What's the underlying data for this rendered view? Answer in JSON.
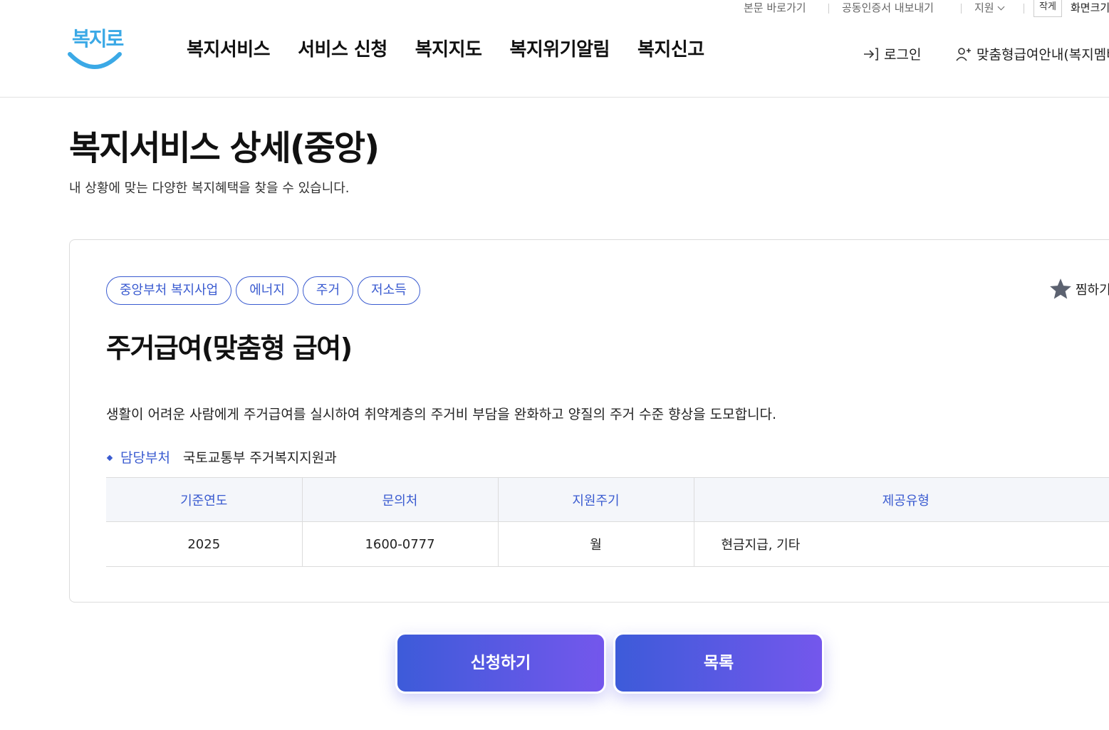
{
  "util": {
    "skip": "본문 바로가기",
    "cert": "공동인증서 내보내기",
    "support": "지원",
    "size_small": "작게",
    "size_label": "화면크기"
  },
  "header": {
    "logo_text": "복지로",
    "gnb": [
      "복지서비스",
      "서비스 신청",
      "복지지도",
      "복지위기알림",
      "복지신고"
    ],
    "login": "로그인",
    "guide": "맞춤형급여안내(복지멤버십)"
  },
  "page": {
    "title": "복지서비스 상세(중앙)",
    "desc": "내 상황에 맞는 다양한 복지혜택을 찾을 수 있습니다."
  },
  "service": {
    "tags": [
      "중앙부처 복지사업",
      "에너지",
      "주거",
      "저소득"
    ],
    "favorite": "찜하기",
    "title": "주거급여(맞춤형 급여)",
    "desc": "생활이 어려운 사람에게 주거급여를 실시하여 취약계층의 주거비 부담을 완화하고 양질의 주거 수준 향상을 도모합니다.",
    "dept_label": "담당부처",
    "dept_value": "국토교통부 주거복지지원과",
    "table": {
      "headers": [
        "기준연도",
        "문의처",
        "지원주기",
        "제공유형"
      ],
      "row": [
        "2025",
        "1600-0777",
        "월",
        "현금지급, 기타"
      ]
    }
  },
  "buttons": {
    "apply": "신청하기",
    "list": "목록"
  },
  "colors": {
    "accent": "#3a5bd0",
    "button_start": "#3d5bd9",
    "button_end": "#7457ec",
    "logo": "#3ba9e6"
  }
}
